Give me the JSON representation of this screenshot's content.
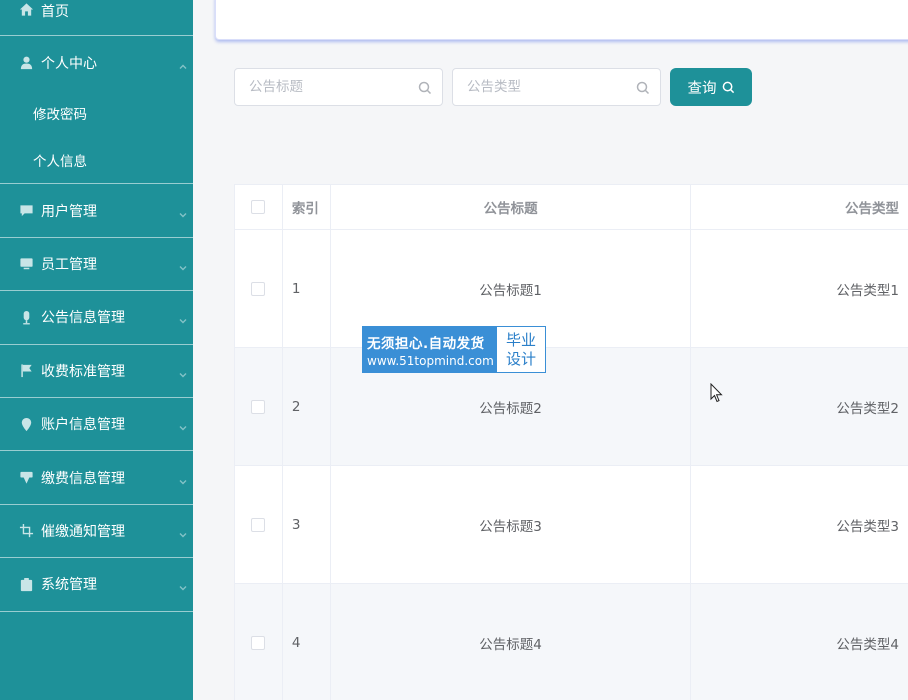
{
  "sidebar": {
    "home": "首页",
    "personal": "个人中心",
    "personal_sub": [
      "修改密码",
      "个人信息"
    ],
    "items": [
      {
        "label": "用户管理",
        "icon": "chat-icon"
      },
      {
        "label": "员工管理",
        "icon": "monitor-icon"
      },
      {
        "label": "公告信息管理",
        "icon": "mic-icon"
      },
      {
        "label": "收费标准管理",
        "icon": "flag-icon"
      },
      {
        "label": "账户信息管理",
        "icon": "location-icon"
      },
      {
        "label": "缴费信息管理",
        "icon": "medal-icon"
      },
      {
        "label": "催缴通知管理",
        "icon": "crop-icon"
      },
      {
        "label": "系统管理",
        "icon": "suitcase-icon"
      }
    ]
  },
  "search": {
    "title_placeholder": "公告标题",
    "type_placeholder": "公告类型",
    "button": "查询"
  },
  "table": {
    "headers": {
      "index": "索引",
      "title": "公告标题",
      "type": "公告类型"
    },
    "rows": [
      {
        "index": "1",
        "title": "公告标题1",
        "type": "公告类型1"
      },
      {
        "index": "2",
        "title": "公告标题2",
        "type": "公告类型2"
      },
      {
        "index": "3",
        "title": "公告标题3",
        "type": "公告类型3"
      },
      {
        "index": "4",
        "title": "公告标题4",
        "type": "公告类型4"
      }
    ]
  },
  "watermark": {
    "line1": "无须担心.自动发货",
    "line2": "www.51topmind.com",
    "right1": "毕业",
    "right2": "设计"
  },
  "colors": {
    "sidebar": "#1e9199",
    "accent": "#1e9199",
    "watermark": "#3a8fd6"
  }
}
